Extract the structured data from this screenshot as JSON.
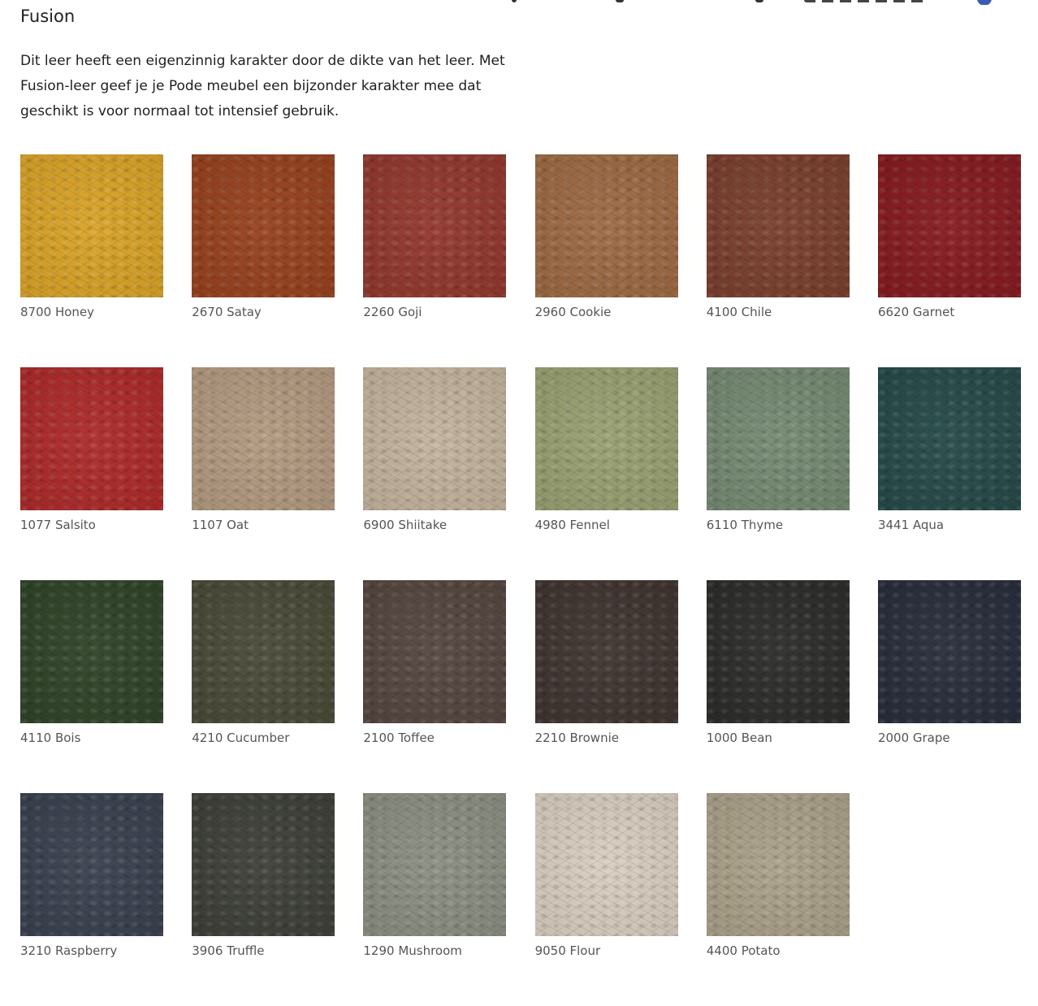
{
  "section": {
    "title": "Fusion",
    "description": "Dit leer heeft een eigenzinnig karakter door de dikte van het leer. Met Fusion-leer geef je je Pode meubel een bijzonder karakter mee dat geschikt is voor normaal tot intensief gebruik."
  },
  "swatches": [
    {
      "label": "8700 Honey",
      "color": "#d9a326"
    },
    {
      "label": "2670 Satay",
      "color": "#98421e"
    },
    {
      "label": "2260 Goji",
      "color": "#93382e"
    },
    {
      "label": "2960 Cookie",
      "color": "#9e6a44"
    },
    {
      "label": "4100 Chile",
      "color": "#7a3f2d"
    },
    {
      "label": "6620 Garnet",
      "color": "#861b20"
    },
    {
      "label": "1077 Salsito",
      "color": "#ae2a2a"
    },
    {
      "label": "1107 Oat",
      "color": "#b39a80"
    },
    {
      "label": "6900 Shiitake",
      "color": "#c3b39d"
    },
    {
      "label": "4980 Fennel",
      "color": "#99a071"
    },
    {
      "label": "6110 Thyme",
      "color": "#758a72"
    },
    {
      "label": "3441 Aqua",
      "color": "#254a48"
    },
    {
      "label": "4110 Bois",
      "color": "#2f4428"
    },
    {
      "label": "4210 Cucumber",
      "color": "#4a4a38"
    },
    {
      "label": "2100 Toffee",
      "color": "#55463f"
    },
    {
      "label": "2210 Brownie",
      "color": "#3f3430"
    },
    {
      "label": "1000 Bean",
      "color": "#2c2c2a"
    },
    {
      "label": "2000 Grape",
      "color": "#282d3b"
    },
    {
      "label": "3210 Raspberry",
      "color": "#3a414f"
    },
    {
      "label": "3906 Truffle",
      "color": "#3e4039"
    },
    {
      "label": "1290 Mushroom",
      "color": "#8b8f82"
    },
    {
      "label": "9050 Flour",
      "color": "#d8cdc0"
    },
    {
      "label": "4400 Potato",
      "color": "#aba18a"
    }
  ]
}
